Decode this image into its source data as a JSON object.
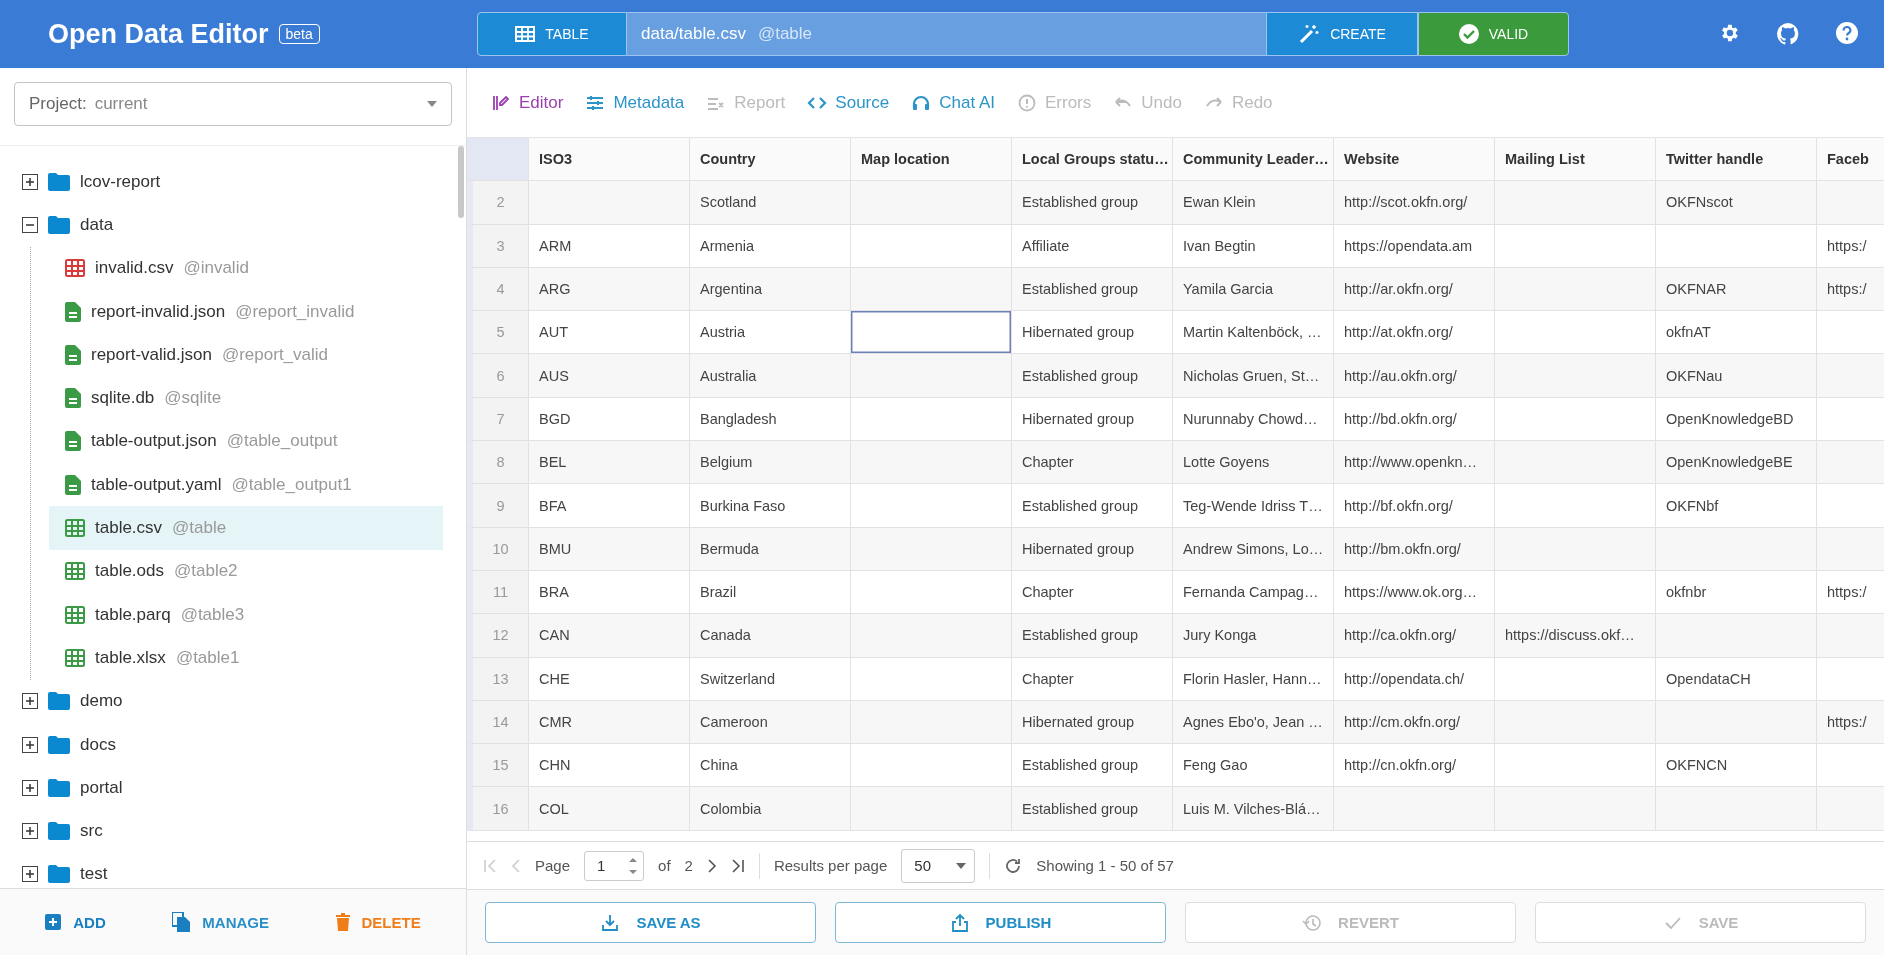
{
  "header": {
    "title": "Open Data Editor",
    "badge": "beta",
    "mode_button": "TABLE",
    "path": "data/table.csv",
    "path_alias": "@table",
    "create_button": "CREATE",
    "valid_button": "VALID"
  },
  "sidebar": {
    "project_label": "Project:",
    "project_value": "current",
    "tree": [
      {
        "kind": "folder",
        "name": "lcov-report",
        "expanded": false,
        "selected": false
      },
      {
        "kind": "folder",
        "name": "data",
        "expanded": true,
        "selected": false,
        "children": [
          {
            "kind": "table",
            "name": "invalid.csv",
            "alias": "@invalid",
            "valid": false,
            "selected": false
          },
          {
            "kind": "file",
            "name": "report-invalid.json",
            "alias": "@report_invalid",
            "valid": true,
            "selected": false
          },
          {
            "kind": "file",
            "name": "report-valid.json",
            "alias": "@report_valid",
            "valid": true,
            "selected": false
          },
          {
            "kind": "file",
            "name": "sqlite.db",
            "alias": "@sqlite",
            "valid": true,
            "selected": false
          },
          {
            "kind": "file",
            "name": "table-output.json",
            "alias": "@table_output",
            "valid": true,
            "selected": false
          },
          {
            "kind": "file",
            "name": "table-output.yaml",
            "alias": "@table_output1",
            "valid": true,
            "selected": false
          },
          {
            "kind": "table",
            "name": "table.csv",
            "alias": "@table",
            "valid": true,
            "selected": true
          },
          {
            "kind": "table",
            "name": "table.ods",
            "alias": "@table2",
            "valid": true,
            "selected": false
          },
          {
            "kind": "table",
            "name": "table.parq",
            "alias": "@table3",
            "valid": true,
            "selected": false
          },
          {
            "kind": "table",
            "name": "table.xlsx",
            "alias": "@table1",
            "valid": true,
            "selected": false
          }
        ]
      },
      {
        "kind": "folder",
        "name": "demo",
        "expanded": false,
        "selected": false
      },
      {
        "kind": "folder",
        "name": "docs",
        "expanded": false,
        "selected": false
      },
      {
        "kind": "folder",
        "name": "portal",
        "expanded": false,
        "selected": false
      },
      {
        "kind": "folder",
        "name": "src",
        "expanded": false,
        "selected": false
      },
      {
        "kind": "folder",
        "name": "test",
        "expanded": false,
        "selected": false
      }
    ],
    "actions": [
      {
        "kind": "add",
        "label": "ADD"
      },
      {
        "kind": "manage",
        "label": "MANAGE"
      },
      {
        "kind": "delete",
        "label": "DELETE"
      }
    ]
  },
  "toolbar": [
    {
      "kind": "editor",
      "label": "Editor",
      "selected": true,
      "disabled": false
    },
    {
      "kind": "metadata",
      "label": "Metadata",
      "selected": false,
      "disabled": false
    },
    {
      "kind": "report",
      "label": "Report",
      "selected": false,
      "disabled": true
    },
    {
      "kind": "source",
      "label": "Source",
      "selected": false,
      "disabled": false
    },
    {
      "kind": "chat",
      "label": "Chat AI",
      "selected": false,
      "disabled": false
    },
    {
      "kind": "errors",
      "label": "Errors",
      "selected": false,
      "disabled": true
    },
    {
      "kind": "undo",
      "label": "Undo",
      "selected": false,
      "disabled": true
    },
    {
      "kind": "redo",
      "label": "Redo",
      "selected": false,
      "disabled": true
    }
  ],
  "table": {
    "columns": [
      "ISO3",
      "Country",
      "Map location",
      "Local Groups statu…",
      "Community Leader…",
      "Website",
      "Mailing List",
      "Twitter handle",
      "Faceb"
    ],
    "rows": [
      {
        "number": "2",
        "cells": [
          {
            "selected": false
          },
          {
            "value": "Scotland",
            "selected": false
          },
          {
            "selected": false
          },
          {
            "value": "Established group",
            "selected": false
          },
          {
            "value": "Ewan Klein",
            "selected": false
          },
          {
            "value": "http://scot.okfn.org/",
            "selected": false
          },
          {
            "selected": false
          },
          {
            "value": "OKFNscot",
            "selected": false
          },
          {
            "selected": false
          }
        ]
      },
      {
        "number": "3",
        "cells": [
          {
            "value": "ARM",
            "selected": false
          },
          {
            "value": "Armenia",
            "selected": false
          },
          {
            "selected": false
          },
          {
            "value": "Affiliate",
            "selected": false
          },
          {
            "value": "Ivan Begtin",
            "selected": false
          },
          {
            "value": "https://opendata.am",
            "selected": false
          },
          {
            "selected": false
          },
          {
            "selected": false
          },
          {
            "value": "https:/",
            "selected": false
          }
        ]
      },
      {
        "number": "4",
        "cells": [
          {
            "value": "ARG",
            "selected": false
          },
          {
            "value": "Argentina",
            "selected": false
          },
          {
            "selected": false
          },
          {
            "value": "Established group",
            "selected": false
          },
          {
            "value": "Yamila Garcia",
            "selected": false
          },
          {
            "value": "http://ar.okfn.org/",
            "selected": false
          },
          {
            "selected": false
          },
          {
            "value": "OKFNAR",
            "selected": false
          },
          {
            "value": "https:/",
            "selected": false
          }
        ]
      },
      {
        "number": "5",
        "cells": [
          {
            "value": "AUT",
            "selected": false
          },
          {
            "value": "Austria",
            "selected": false
          },
          {
            "selected": true
          },
          {
            "value": "Hibernated group",
            "selected": false
          },
          {
            "value": "Martin Kaltenböck, …",
            "selected": false
          },
          {
            "value": "http://at.okfn.org/",
            "selected": false
          },
          {
            "selected": false
          },
          {
            "value": "okfnAT",
            "selected": false
          },
          {
            "selected": false
          }
        ]
      },
      {
        "number": "6",
        "cells": [
          {
            "value": "AUS",
            "selected": false
          },
          {
            "value": "Australia",
            "selected": false
          },
          {
            "selected": false
          },
          {
            "value": "Established group",
            "selected": false
          },
          {
            "value": "Nicholas Gruen, St…",
            "selected": false
          },
          {
            "value": "http://au.okfn.org/",
            "selected": false
          },
          {
            "selected": false
          },
          {
            "value": "OKFNau",
            "selected": false
          },
          {
            "selected": false
          }
        ]
      },
      {
        "number": "7",
        "cells": [
          {
            "value": "BGD",
            "selected": false
          },
          {
            "value": "Bangladesh",
            "selected": false
          },
          {
            "selected": false
          },
          {
            "value": "Hibernated group",
            "selected": false
          },
          {
            "value": "Nurunnaby Chowd…",
            "selected": false
          },
          {
            "value": "http://bd.okfn.org/",
            "selected": false
          },
          {
            "selected": false
          },
          {
            "value": "OpenKnowledgeBD",
            "selected": false
          },
          {
            "selected": false
          }
        ]
      },
      {
        "number": "8",
        "cells": [
          {
            "value": "BEL",
            "selected": false
          },
          {
            "value": "Belgium",
            "selected": false
          },
          {
            "selected": false
          },
          {
            "value": "Chapter",
            "selected": false
          },
          {
            "value": "Lotte Goyens",
            "selected": false
          },
          {
            "value": "http://www.openkn…",
            "selected": false
          },
          {
            "selected": false
          },
          {
            "value": "OpenKnowledgeBE",
            "selected": false
          },
          {
            "selected": false
          }
        ]
      },
      {
        "number": "9",
        "cells": [
          {
            "value": "BFA",
            "selected": false
          },
          {
            "value": "Burkina Faso",
            "selected": false
          },
          {
            "selected": false
          },
          {
            "value": "Established group",
            "selected": false
          },
          {
            "value": "Teg-Wende Idriss T…",
            "selected": false
          },
          {
            "value": "http://bf.okfn.org/",
            "selected": false
          },
          {
            "selected": false
          },
          {
            "value": "OKFNbf",
            "selected": false
          },
          {
            "selected": false
          }
        ]
      },
      {
        "number": "10",
        "cells": [
          {
            "value": "BMU",
            "selected": false
          },
          {
            "value": "Bermuda",
            "selected": false
          },
          {
            "selected": false
          },
          {
            "value": "Hibernated group",
            "selected": false
          },
          {
            "value": "Andrew Simons, Lo…",
            "selected": false
          },
          {
            "value": "http://bm.okfn.org/",
            "selected": false
          },
          {
            "selected": false
          },
          {
            "selected": false
          },
          {
            "selected": false
          }
        ]
      },
      {
        "number": "11",
        "cells": [
          {
            "value": "BRA",
            "selected": false
          },
          {
            "value": "Brazil",
            "selected": false
          },
          {
            "selected": false
          },
          {
            "value": "Chapter",
            "selected": false
          },
          {
            "value": "Fernanda Campag…",
            "selected": false
          },
          {
            "value": "https://www.ok.org…",
            "selected": false
          },
          {
            "selected": false
          },
          {
            "value": "okfnbr",
            "selected": false
          },
          {
            "value": "https:/",
            "selected": false
          }
        ]
      },
      {
        "number": "12",
        "cells": [
          {
            "value": "CAN",
            "selected": false
          },
          {
            "value": "Canada",
            "selected": false
          },
          {
            "selected": false
          },
          {
            "value": "Established group",
            "selected": false
          },
          {
            "value": "Jury Konga",
            "selected": false
          },
          {
            "value": "http://ca.okfn.org/",
            "selected": false
          },
          {
            "value": "https://discuss.okf…",
            "selected": false
          },
          {
            "selected": false
          },
          {
            "selected": false
          }
        ]
      },
      {
        "number": "13",
        "cells": [
          {
            "value": "CHE",
            "selected": false
          },
          {
            "value": "Switzerland",
            "selected": false
          },
          {
            "selected": false
          },
          {
            "value": "Chapter",
            "selected": false
          },
          {
            "value": "Florin Hasler, Hann…",
            "selected": false
          },
          {
            "value": "http://opendata.ch/",
            "selected": false
          },
          {
            "selected": false
          },
          {
            "value": "OpendataCH",
            "selected": false
          },
          {
            "selected": false
          }
        ]
      },
      {
        "number": "14",
        "cells": [
          {
            "value": "CMR",
            "selected": false
          },
          {
            "value": "Cameroon",
            "selected": false
          },
          {
            "selected": false
          },
          {
            "value": "Hibernated group",
            "selected": false
          },
          {
            "value": "Agnes Ebo'o, Jean …",
            "selected": false
          },
          {
            "value": "http://cm.okfn.org/",
            "selected": false
          },
          {
            "selected": false
          },
          {
            "selected": false
          },
          {
            "value": "https:/",
            "selected": false
          }
        ]
      },
      {
        "number": "15",
        "cells": [
          {
            "value": "CHN",
            "selected": false
          },
          {
            "value": "China",
            "selected": false
          },
          {
            "selected": false
          },
          {
            "value": "Established group",
            "selected": false
          },
          {
            "value": "Feng Gao",
            "selected": false
          },
          {
            "value": "http://cn.okfn.org/",
            "selected": false
          },
          {
            "selected": false
          },
          {
            "value": "OKFNCN",
            "selected": false
          },
          {
            "selected": false
          }
        ]
      },
      {
        "number": "16",
        "cells": [
          {
            "value": "COL",
            "selected": false
          },
          {
            "value": "Colombia",
            "selected": false
          },
          {
            "selected": false
          },
          {
            "value": "Established group",
            "selected": false
          },
          {
            "value": "Luis M. Vilches-Blá…",
            "selected": false
          },
          {
            "selected": false
          },
          {
            "selected": false
          },
          {
            "selected": false
          },
          {
            "selected": false
          }
        ]
      }
    ]
  },
  "pagination": {
    "page_label": "Page",
    "page_value": "1",
    "of_label": "of",
    "page_count": "2",
    "per_page_label": "Results per page",
    "per_page_value": "50",
    "showing": "Showing 1 - 50 of 57",
    "first_disabled": true,
    "prev_disabled": true,
    "next_disabled": false,
    "last_disabled": false
  },
  "actions": [
    {
      "kind": "save_as",
      "label": "SAVE AS",
      "disabled": false
    },
    {
      "kind": "publish",
      "label": "PUBLISH",
      "disabled": false
    },
    {
      "kind": "revert",
      "label": "REVERT",
      "disabled": true
    },
    {
      "kind": "save",
      "label": "SAVE",
      "disabled": true
    }
  ]
}
